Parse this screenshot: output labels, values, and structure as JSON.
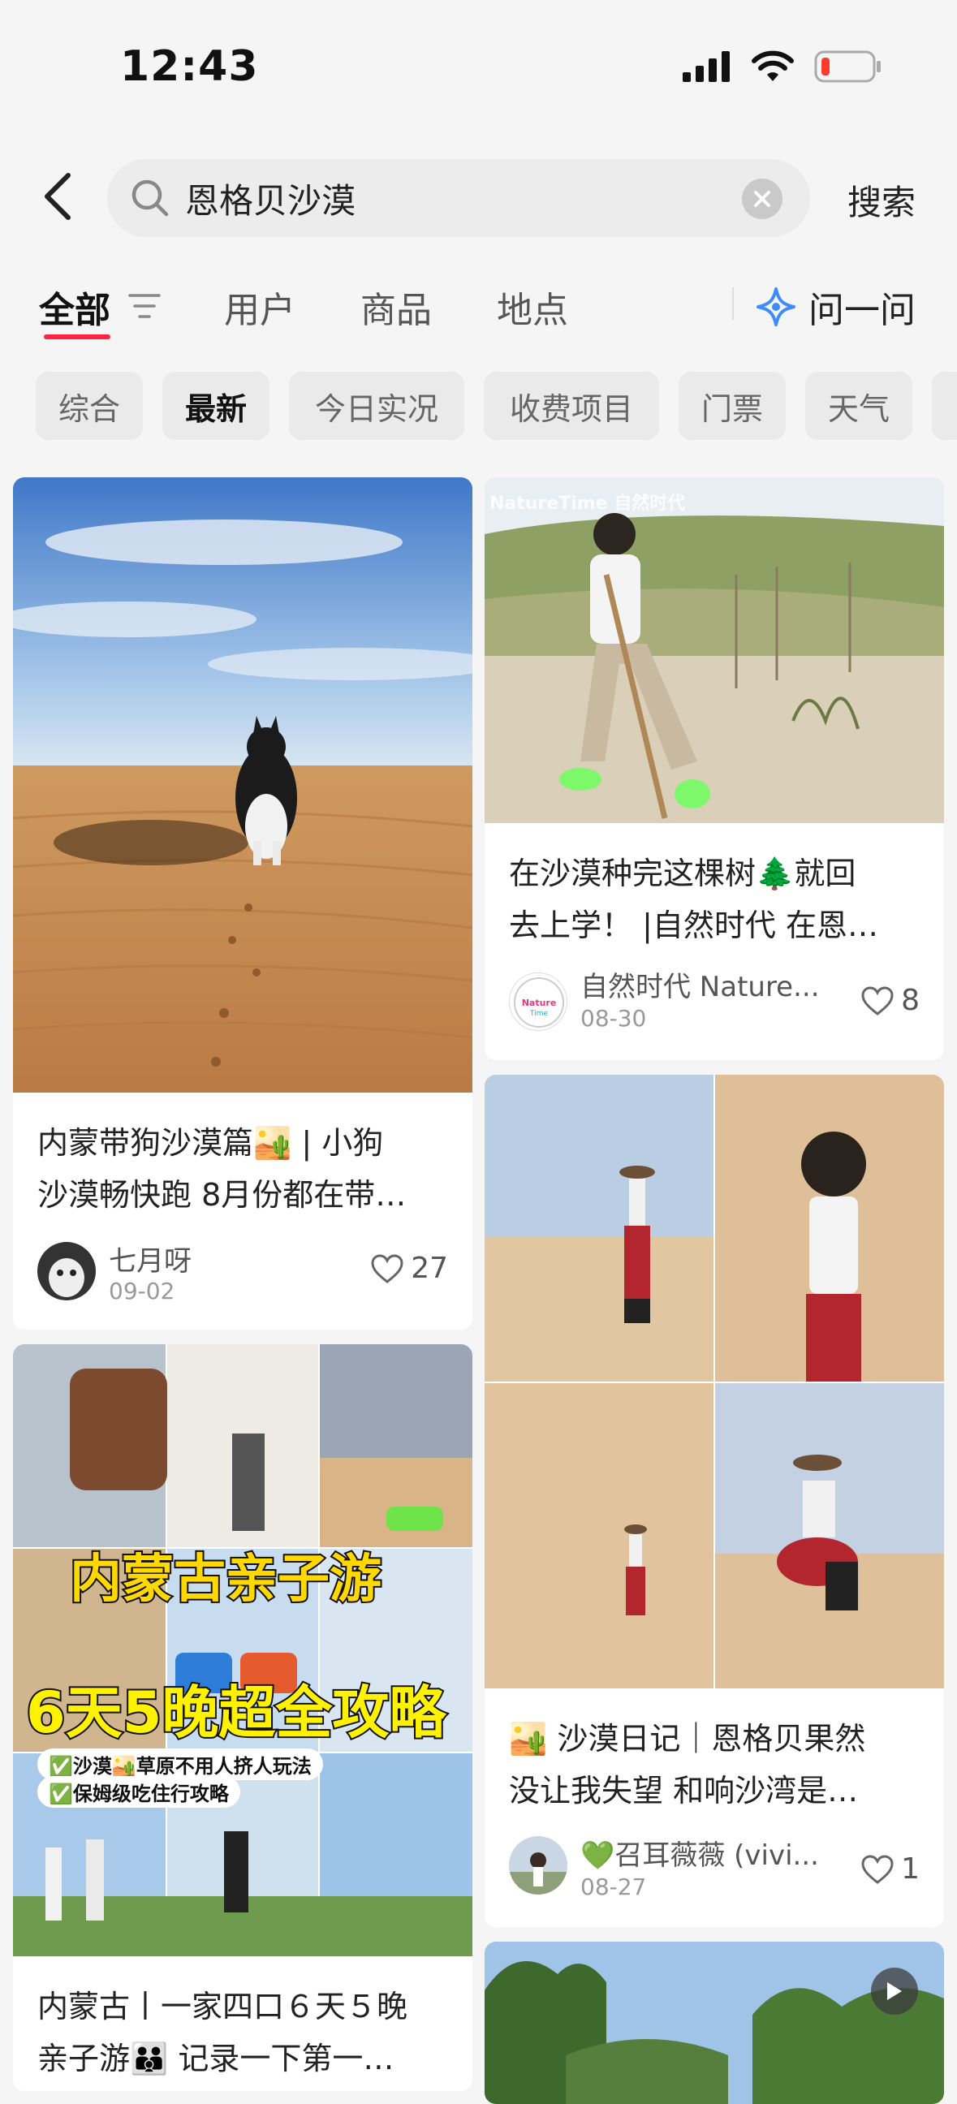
{
  "status": {
    "time": "12:43"
  },
  "search": {
    "query": "恩格贝沙漠",
    "button": "搜索"
  },
  "tabs": [
    {
      "label": "全部",
      "active": true
    },
    {
      "label": "用户"
    },
    {
      "label": "商品"
    },
    {
      "label": "地点"
    }
  ],
  "ask": {
    "label": "问一问"
  },
  "chips": [
    {
      "label": "综合"
    },
    {
      "label": "最新",
      "active": true
    },
    {
      "label": "今日实况"
    },
    {
      "label": "收费项目"
    },
    {
      "label": "门票"
    },
    {
      "label": "天气"
    }
  ],
  "posts": [
    {
      "title_line1": "内蒙带狗沙漠篇🏜️ | 小狗",
      "title_line2": "沙漠畅快跑 8月份都在带…",
      "author": "七月呀",
      "date": "09-02",
      "likes": "27"
    },
    {
      "watermark": "NatureTime 自然时代",
      "title_line1": "在沙漠种完这棵树🌲就回",
      "title_line2": "去上学！ |自然时代 在恩…",
      "author": "自然时代 Nature...",
      "date": "08-30",
      "likes": "8",
      "avatar_text": "NatureTime"
    },
    {
      "title_line1": "🏜️ 沙漠日记｜恩格贝果然",
      "title_line2": "没让我失望 和响沙湾是…",
      "author": "💚召耳薇薇 (vivi...",
      "date": "08-27",
      "likes": "1"
    },
    {
      "overlay_line1": "内蒙古亲子游",
      "overlay_line2": "6天5晚超全攻略",
      "badge1": "✅沙漠🏜️草原不用人挤人玩法",
      "badge2": "✅保姆级吃住行攻略",
      "title_line1": "内蒙古丨一家四口６天５晚",
      "title_line2": "亲子游👪 记录一下第一…"
    },
    {}
  ],
  "colors": {
    "accent": "#ff2442",
    "chip_bg": "#eaeaea",
    "overlay_yellow": "#ffd800"
  }
}
